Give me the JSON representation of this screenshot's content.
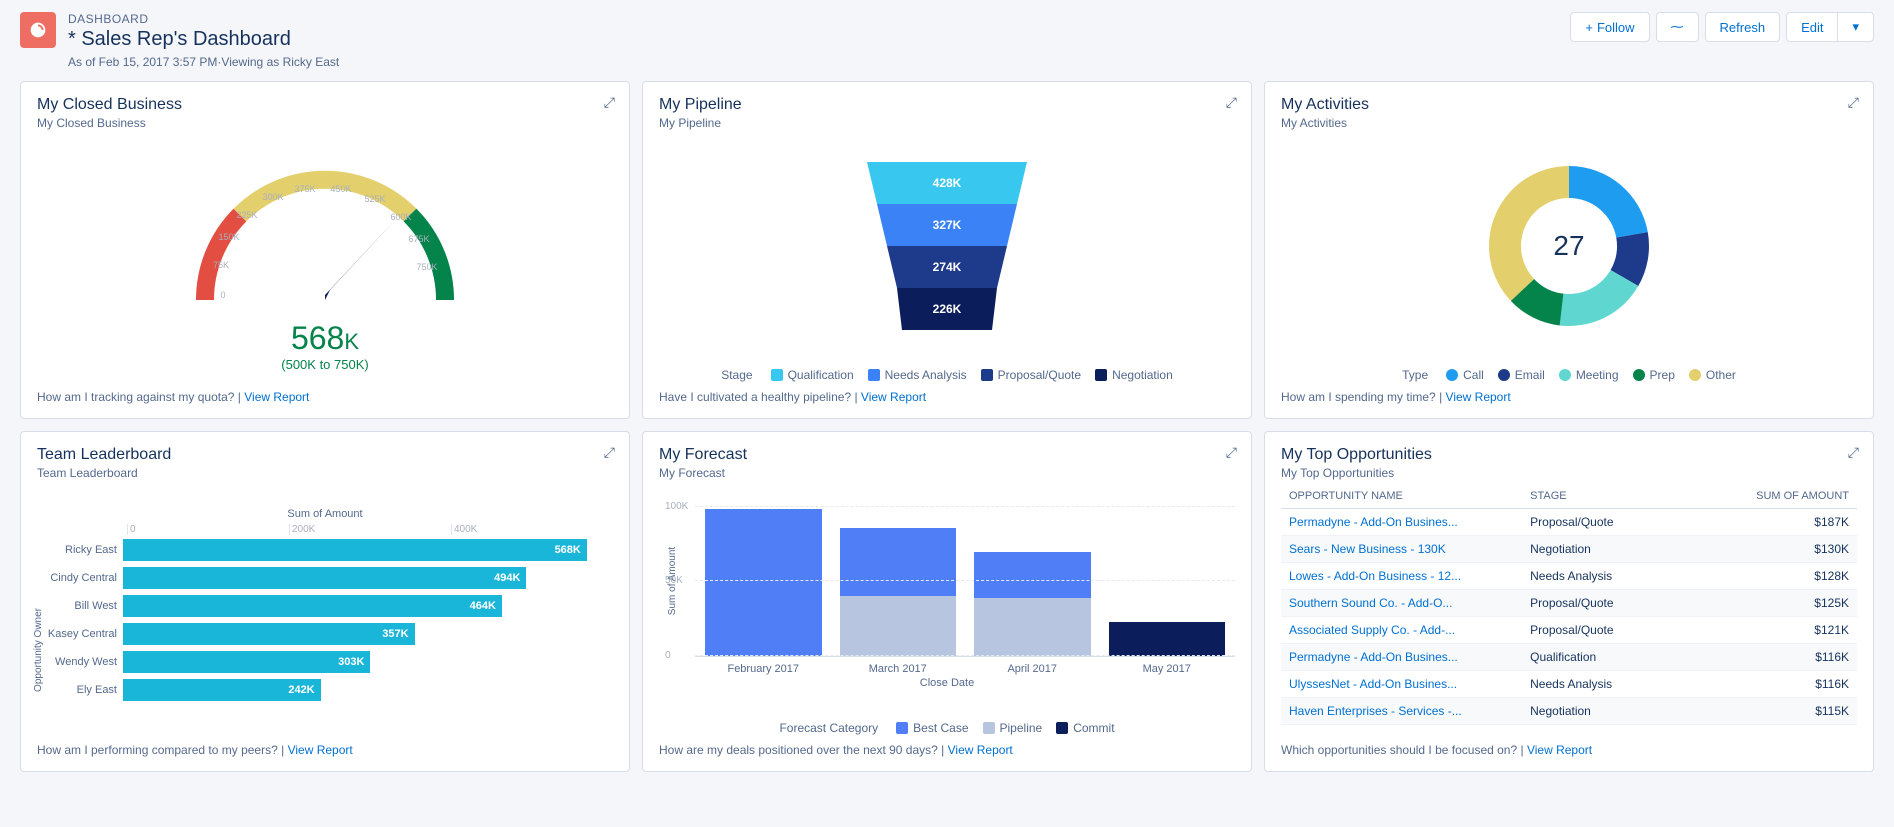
{
  "header": {
    "label": "DASHBOARD",
    "title": "* Sales Rep's Dashboard",
    "sub": "As of Feb 15, 2017 3:57 PM·Viewing as Ricky East",
    "follow": "Follow",
    "refresh": "Refresh",
    "edit": "Edit"
  },
  "cards": {
    "closed": {
      "title": "My Closed Business",
      "sub": "My Closed Business",
      "value": "568",
      "unit": "K",
      "range": "(500K to 750K)",
      "footer_q": "How am I tracking against my quota?",
      "view": "View Report"
    },
    "pipeline": {
      "title": "My Pipeline",
      "sub": "My Pipeline",
      "legend_title": "Stage",
      "footer_q": "Have I cultivated a healthy pipeline?",
      "view": "View Report"
    },
    "activities": {
      "title": "My Activities",
      "sub": "My Activities",
      "center": "27",
      "legend_title": "Type",
      "footer_q": "How am I spending my time?",
      "view": "View Report"
    },
    "leaderboard": {
      "title": "Team Leaderboard",
      "sub": "Team Leaderboard",
      "chart_title": "Sum of Amount",
      "ylabel": "Opportunity Owner",
      "footer_q": "How am I performing compared to my peers?",
      "view": "View Report"
    },
    "forecast": {
      "title": "My Forecast",
      "sub": "My Forecast",
      "legend_title": "Forecast Category",
      "ylabel": "Sum of Amount",
      "xlabel": "Close Date",
      "footer_q": "How are my deals positioned over the next 90 days?",
      "view": "View Report"
    },
    "opps": {
      "title": "My Top Opportunities",
      "sub": "My Top Opportunities",
      "cols": {
        "name": "OPPORTUNITY NAME",
        "stage": "STAGE",
        "amount": "SUM OF AMOUNT"
      },
      "footer_q": "Which opportunities should I be focused on?",
      "view": "View Report"
    }
  },
  "chart_data": [
    {
      "id": "closed_gauge",
      "type": "gauge",
      "title": "My Closed Business",
      "value": 568,
      "unit": "K",
      "range_label": "(500K to 750K)",
      "min": 0,
      "max": 750,
      "ticks": [
        "0",
        "75K",
        "150K",
        "225K",
        "300K",
        "375K",
        "450K",
        "525K",
        "600K",
        "675K",
        "750K"
      ],
      "zones": [
        {
          "from": 0,
          "to": 250,
          "color": "#e34e42"
        },
        {
          "from": 250,
          "to": 500,
          "color": "#e4cf6d"
        },
        {
          "from": 500,
          "to": 750,
          "color": "#04844b"
        }
      ]
    },
    {
      "id": "pipeline_funnel",
      "type": "funnel",
      "title": "My Pipeline",
      "series": [
        {
          "name": "Qualification",
          "value": 428,
          "label": "428K",
          "color": "#38c8ef"
        },
        {
          "name": "Needs Analysis",
          "value": 327,
          "label": "327K",
          "color": "#3b82f6"
        },
        {
          "name": "Proposal/Quote",
          "value": 274,
          "label": "274K",
          "color": "#1e3a8a"
        },
        {
          "name": "Negotiation",
          "value": 226,
          "label": "226K",
          "color": "#0b1e5b"
        }
      ],
      "legend_title": "Stage"
    },
    {
      "id": "activities_donut",
      "type": "pie",
      "title": "My Activities",
      "center_value": 27,
      "series": [
        {
          "name": "Call",
          "value": 6,
          "color": "#1e9cef"
        },
        {
          "name": "Email",
          "value": 3,
          "color": "#1e3a8a"
        },
        {
          "name": "Meeting",
          "value": 5,
          "color": "#5fd7d0"
        },
        {
          "name": "Prep",
          "value": 3,
          "color": "#04844b"
        },
        {
          "name": "Other",
          "value": 10,
          "color": "#e4cf6d"
        }
      ],
      "legend_title": "Type"
    },
    {
      "id": "leaderboard_bars",
      "type": "bar",
      "orientation": "horizontal",
      "title": "Sum of Amount",
      "ylabel": "Opportunity Owner",
      "xlim": [
        0,
        600
      ],
      "xticks": [
        "0",
        "200K",
        "400K"
      ],
      "categories": [
        "Ricky East",
        "Cindy Central",
        "Bill West",
        "Kasey Central",
        "Wendy West",
        "Ely East"
      ],
      "values": [
        568,
        494,
        464,
        357,
        303,
        242
      ],
      "value_labels": [
        "568K",
        "494K",
        "464K",
        "357K",
        "303K",
        "242K"
      ],
      "color": "#1ab6d9"
    },
    {
      "id": "forecast_stacked",
      "type": "bar",
      "stacked": true,
      "title": "My Forecast",
      "xlabel": "Close Date",
      "ylabel": "Sum of Amount",
      "yticks": [
        "0",
        "50K",
        "100K"
      ],
      "ylim": [
        0,
        115
      ],
      "categories": [
        "February 2017",
        "March 2017",
        "April 2017",
        "May 2017"
      ],
      "series": [
        {
          "name": "Best Case",
          "color": "#4f7ef7",
          "values": [
            112,
            52,
            35,
            0
          ]
        },
        {
          "name": "Pipeline",
          "color": "#b7c5e1",
          "values": [
            0,
            46,
            44,
            0
          ]
        },
        {
          "name": "Commit",
          "color": "#0b1e5b",
          "values": [
            0,
            0,
            0,
            26
          ]
        }
      ],
      "legend_title": "Forecast Category"
    },
    {
      "id": "top_opps",
      "type": "table",
      "title": "My Top Opportunities",
      "columns": [
        "OPPORTUNITY NAME",
        "STAGE",
        "SUM OF AMOUNT"
      ],
      "rows": [
        [
          "Permadyne - Add-On Busines...",
          "Proposal/Quote",
          "$187K"
        ],
        [
          "Sears - New Business - 130K",
          "Negotiation",
          "$130K"
        ],
        [
          "Lowes - Add-On Business - 12...",
          "Needs Analysis",
          "$128K"
        ],
        [
          "Southern Sound Co. - Add-O...",
          "Proposal/Quote",
          "$125K"
        ],
        [
          "Associated Supply Co. - Add-...",
          "Proposal/Quote",
          "$121K"
        ],
        [
          "Permadyne - Add-On Busines...",
          "Qualification",
          "$116K"
        ],
        [
          "UlyssesNet - Add-On Busines...",
          "Needs Analysis",
          "$116K"
        ],
        [
          "Haven Enterprises - Services -...",
          "Negotiation",
          "$115K"
        ]
      ]
    }
  ]
}
